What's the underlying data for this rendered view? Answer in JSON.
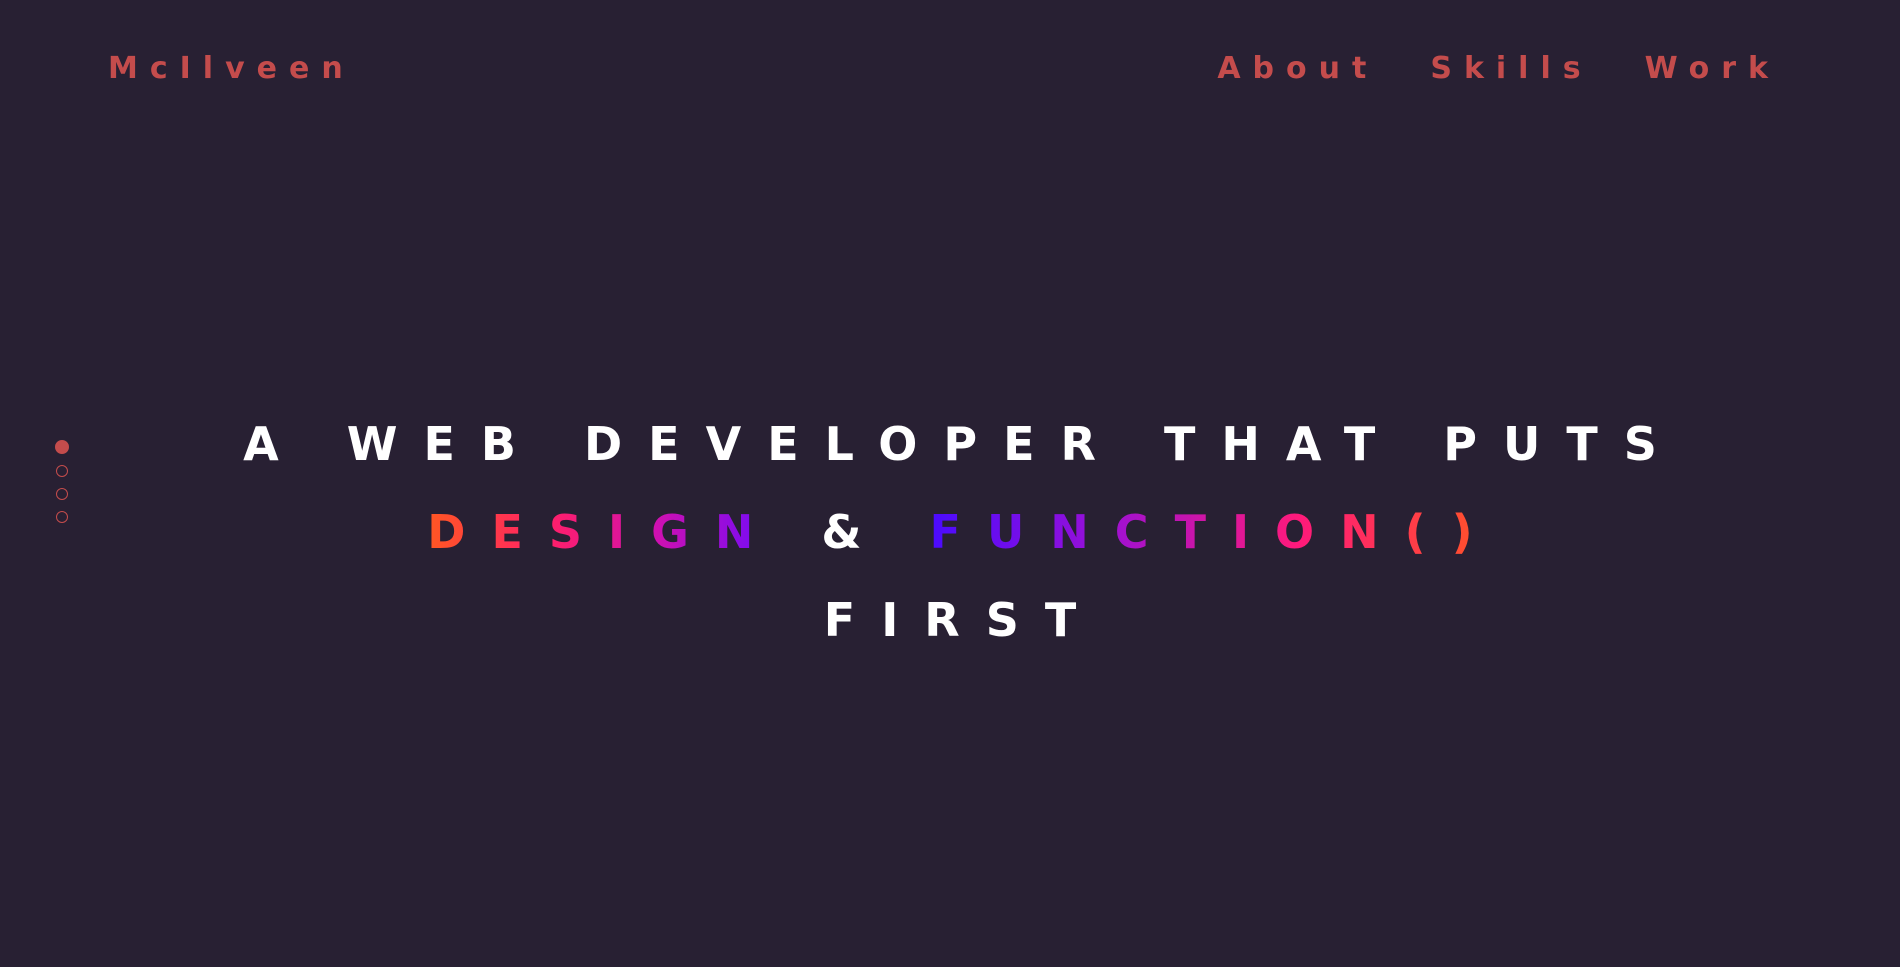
{
  "brand": {
    "name": "McIlveen"
  },
  "nav": {
    "items": [
      {
        "label": "About"
      },
      {
        "label": "Skills"
      },
      {
        "label": "Work"
      }
    ]
  },
  "section_dots": {
    "count": 4,
    "active_index": 0
  },
  "hero": {
    "line1": "A WEB DEVELOPER THAT PUTS",
    "design": "DESIGN",
    "ampersand": "&",
    "function": "FUNCTION()",
    "line3": "FIRST"
  },
  "colors": {
    "background": "#282033",
    "accent": "#c44c4c",
    "hero_text": "#ffffff",
    "gradient_orange": "#ff5722",
    "gradient_pink": "#ff1f6a",
    "gradient_violet": "#6a0aff"
  }
}
